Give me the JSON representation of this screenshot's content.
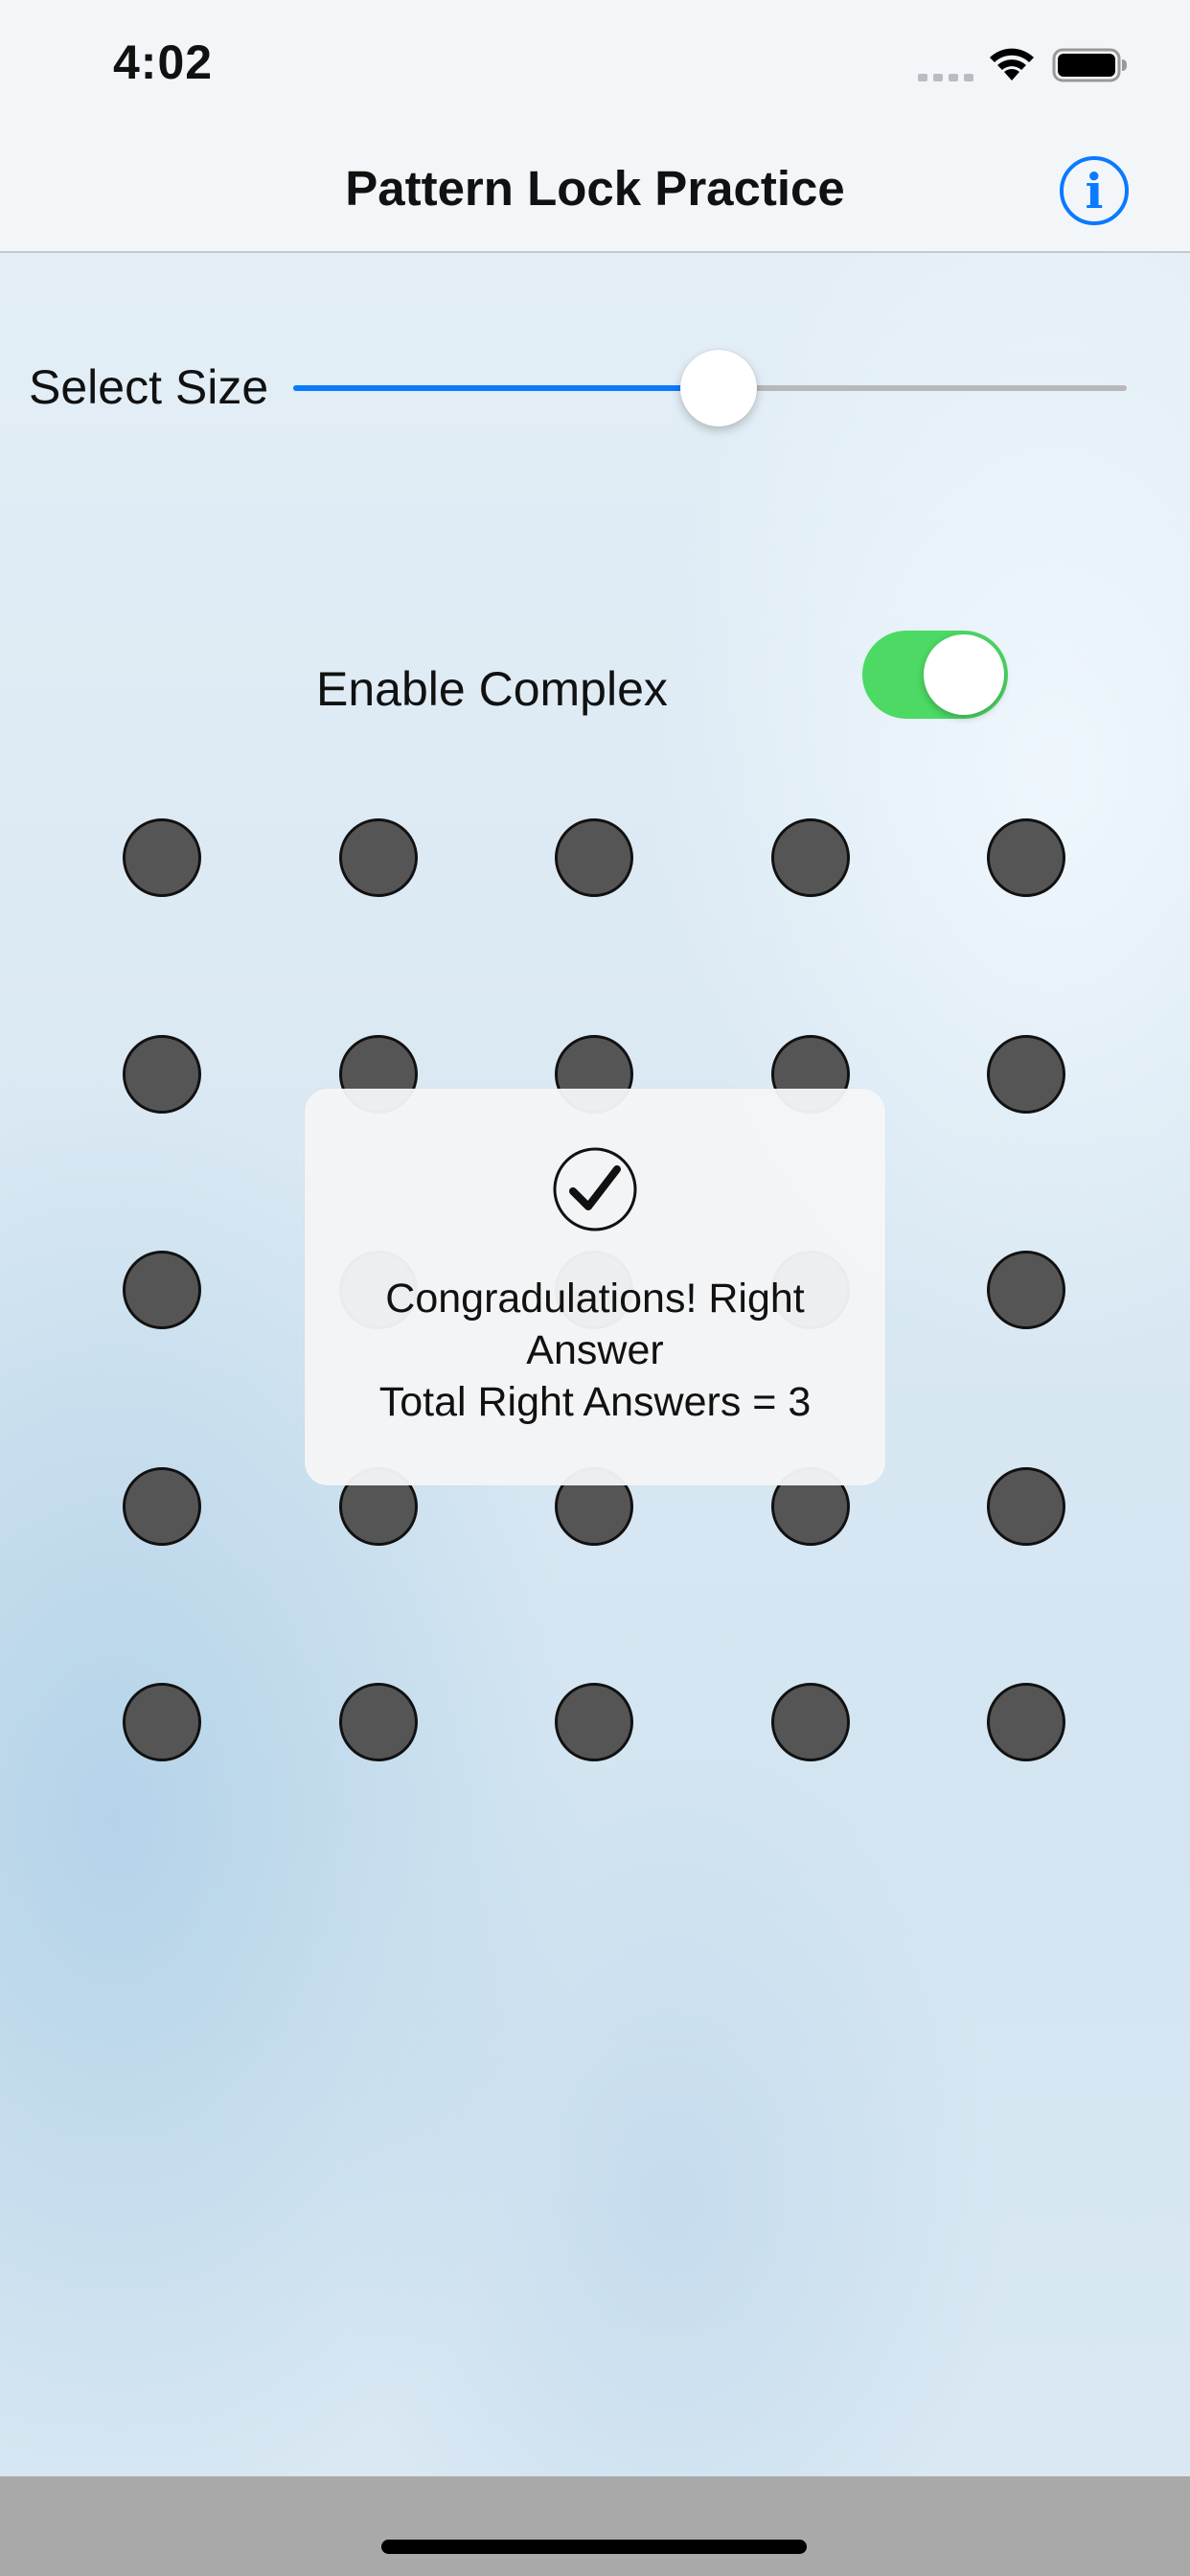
{
  "status_bar": {
    "time": "4:02"
  },
  "nav": {
    "title": "Pattern Lock Practice"
  },
  "size_slider": {
    "label": "Select Size",
    "value_fraction": 0.51
  },
  "complex_toggle": {
    "label": "Enable Complex",
    "on": true
  },
  "grid": {
    "rows": 5,
    "columns": 5
  },
  "alert": {
    "message_line1": "Congradulations! Right",
    "message_line2": "Answer",
    "message_line3": "Total Right Answers = 3"
  },
  "colors": {
    "accent": "#0a7aff",
    "toggle_on": "#4cd964",
    "dot_fill": "#555555"
  }
}
